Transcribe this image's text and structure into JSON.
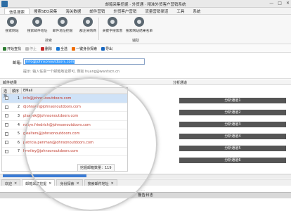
{
  "window": {
    "title": "邮箱采集挖掘 · 外贸通 · 精准外贸客户营销系统",
    "buttons": [
      "—",
      "□",
      "✕"
    ]
  },
  "menu": [
    "信息搜索",
    "搜索SEO采集",
    "海关数据",
    "邮件营销",
    "外贸客户营销",
    "流量营销渠道",
    "工具",
    "系统"
  ],
  "ribbon": {
    "buttons": [
      "搜索网站",
      "搜索邮件地址",
      "邮件地址挖掘",
      "群企采购商",
      "关键字搜索客",
      "搜索网站结果名单"
    ],
    "groups": [
      "搜索",
      "辅助"
    ]
  },
  "toolbar": {
    "start": "开始查找",
    "stop": "停止",
    "delete": "删除",
    "select_all": "全选",
    "find": "一键身份探索",
    "export": "导出"
  },
  "form": {
    "email_label": "邮箱:",
    "email_value": "info@johnsonoutdoors.com",
    "hint": "提示: 输入任意一个邮箱地址即可, 例如 huang@wantscn.cn"
  },
  "results": {
    "title": "邮件结果",
    "headers": [
      "选择",
      "顺序",
      "EMail"
    ],
    "rows": [
      {
        "n": "1",
        "email": "info@johnsonoutdoors.com"
      },
      {
        "n": "2",
        "email": "djohnson@johnsonoutdoors.com"
      },
      {
        "n": "3",
        "email": "plsayek@johnsonoutdoors.com"
      },
      {
        "n": "4",
        "email": "robyn.friedrich@johnsonoutdoors.com"
      },
      {
        "n": "5",
        "email": "gwalters@johnsonoutdoors.com"
      },
      {
        "n": "6",
        "email": "patricia.penman@johnsonoutdoors.com"
      },
      {
        "n": "7",
        "email": "hmriley@johnsonoutdoors.com"
      }
    ],
    "count_text": "挖掘邮箱数量：119"
  },
  "channels": {
    "title": "分析通道",
    "items": [
      "分析通道1",
      "分析通道2",
      "分析通道3",
      "分析通道4",
      "分析通道5",
      "分析通道6"
    ]
  },
  "progress": 0.3,
  "tabs": [
    {
      "label": "欢迎",
      "active": false
    },
    {
      "label": "邮箱采集挖掘",
      "active": true
    },
    {
      "label": "身份探索",
      "active": false
    },
    {
      "label": "搜索邮件地址",
      "active": false
    }
  ],
  "log_bar": "报告日志",
  "colors": {
    "accent": "#3a7bd5",
    "email_text": "#c0392b",
    "channel_btn": "#555555"
  }
}
